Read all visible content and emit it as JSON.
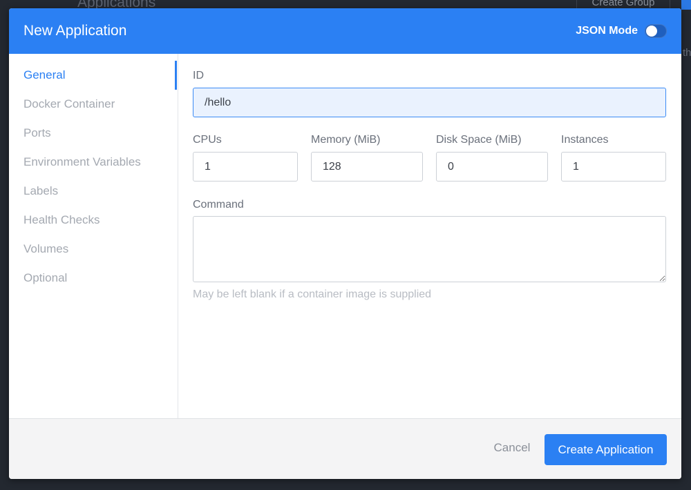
{
  "background": {
    "title": "Applications",
    "create_group_label": "Create Group",
    "side_text": "th"
  },
  "modal": {
    "title": "New Application",
    "json_mode_label": "JSON Mode",
    "json_mode_enabled": false
  },
  "sidebar": {
    "items": [
      {
        "label": "General",
        "active": true
      },
      {
        "label": "Docker Container",
        "active": false
      },
      {
        "label": "Ports",
        "active": false
      },
      {
        "label": "Environment Variables",
        "active": false
      },
      {
        "label": "Labels",
        "active": false
      },
      {
        "label": "Health Checks",
        "active": false
      },
      {
        "label": "Volumes",
        "active": false
      },
      {
        "label": "Optional",
        "active": false
      }
    ]
  },
  "form": {
    "id": {
      "label": "ID",
      "value": "/hello"
    },
    "cpus": {
      "label": "CPUs",
      "value": "1"
    },
    "memory": {
      "label": "Memory (MiB)",
      "value": "128"
    },
    "disk": {
      "label": "Disk Space (MiB)",
      "value": "0"
    },
    "instances": {
      "label": "Instances",
      "value": "1"
    },
    "command": {
      "label": "Command",
      "value": "",
      "help": "May be left blank if a container image is supplied"
    }
  },
  "footer": {
    "cancel_label": "Cancel",
    "create_label": "Create Application"
  },
  "colors": {
    "accent": "#2b80f3",
    "muted_text": "#a4a9b1",
    "overlay": "#232830"
  }
}
